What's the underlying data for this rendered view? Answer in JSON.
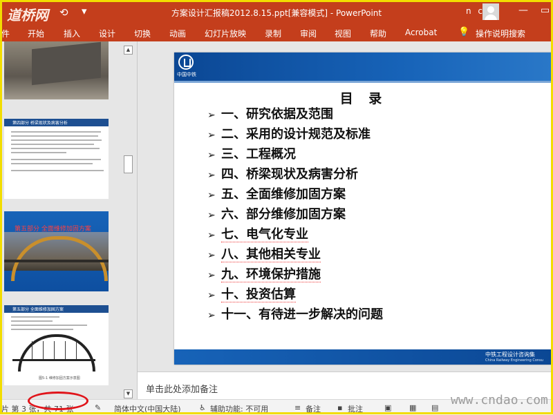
{
  "titlebar": {
    "logo": "道桥网",
    "title": "方案设计汇报稿2012.8.15.ppt[兼容模式]  -  PowerPoint",
    "user": "n c",
    "minimize_icon": "minimize-icon",
    "close_icon": "close-icon"
  },
  "ribbon": {
    "tabs": [
      "件",
      "开始",
      "插入",
      "设计",
      "切换",
      "动画",
      "幻灯片放映",
      "录制",
      "审阅",
      "视图",
      "帮助",
      "Acrobat",
      "操作说明搜索"
    ]
  },
  "thumbnails": {
    "slide2_header": "第四部分  桥梁现状及病害分析",
    "slide3_title": "第五部分  全面维修加固方案",
    "slide4_header": "第五部分  全面维修加固方案",
    "slide4_caption": "图5-1  维修加固方案示意图"
  },
  "slide": {
    "company_logo_text": "中国中铁",
    "title": "目  录",
    "items": [
      "一、研究依据及范围",
      "二、采用的设计规范及标准",
      "三、工程概况",
      "四、桥梁现状及病害分析",
      "五、全面维修加固方案",
      "六、部分维修加固方案",
      "七、电气化专业",
      "八、其他相关专业",
      "九、环境保护措施",
      "十、投资估算",
      "十一、有待进一步解决的问题"
    ],
    "footer_cn": "中铁工程设计咨询集",
    "footer_en": "China Railway Engineering Consu"
  },
  "notes": {
    "placeholder": "单击此处添加备注"
  },
  "statusbar": {
    "slide_position": "片 第 3 张，共 71 张",
    "language": "简体中文(中国大陆)",
    "accessibility": "辅助功能: 不可用",
    "notes_btn": "备注",
    "comments_btn": "批注"
  },
  "watermark": "www.cndao.com"
}
